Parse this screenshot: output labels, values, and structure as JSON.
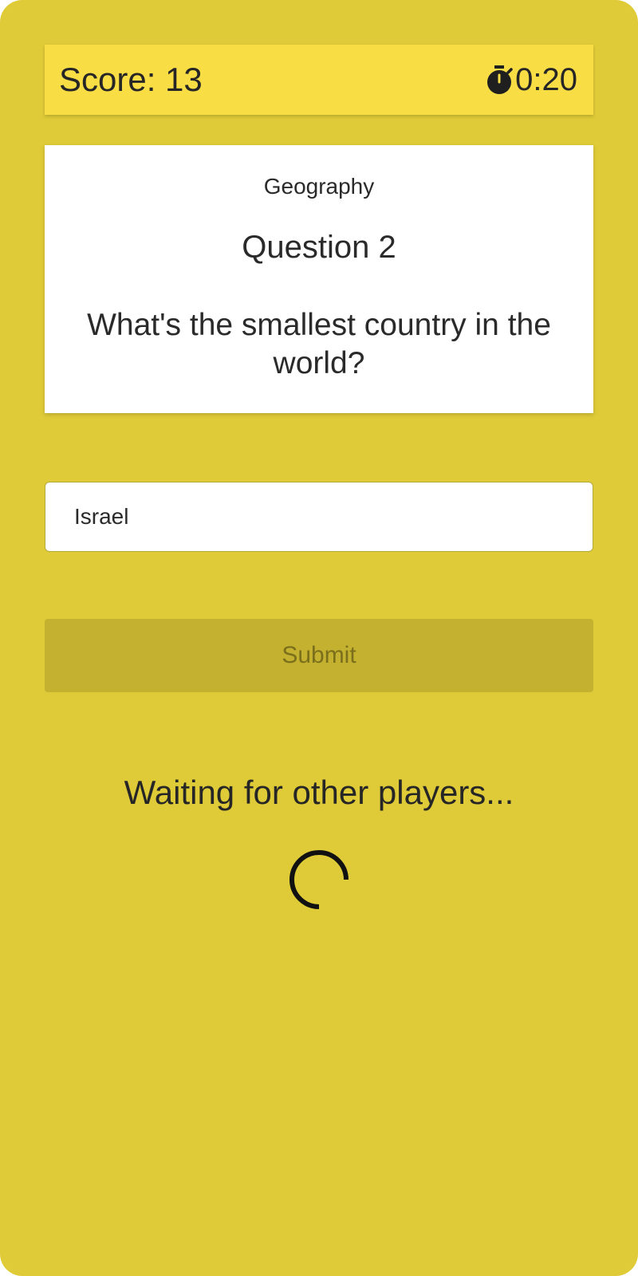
{
  "header": {
    "score_label": "Score: 13",
    "timer_icon": "stopwatch-icon",
    "timer_value": "0:20",
    "background_color": "#f9dd45"
  },
  "question": {
    "category": "Geography",
    "number_label": "Question 2",
    "text": "What's the smallest country in the world?"
  },
  "answer": {
    "value": "Israel",
    "placeholder": ""
  },
  "submit": {
    "label": "Submit",
    "enabled": false
  },
  "status": {
    "waiting_text": "Waiting for other players...",
    "spinner_icon": "loading-spinner-icon"
  },
  "colors": {
    "app_background": "#dfcb37",
    "card_background": "#ffffff",
    "disabled_button": "#c3b12f"
  }
}
